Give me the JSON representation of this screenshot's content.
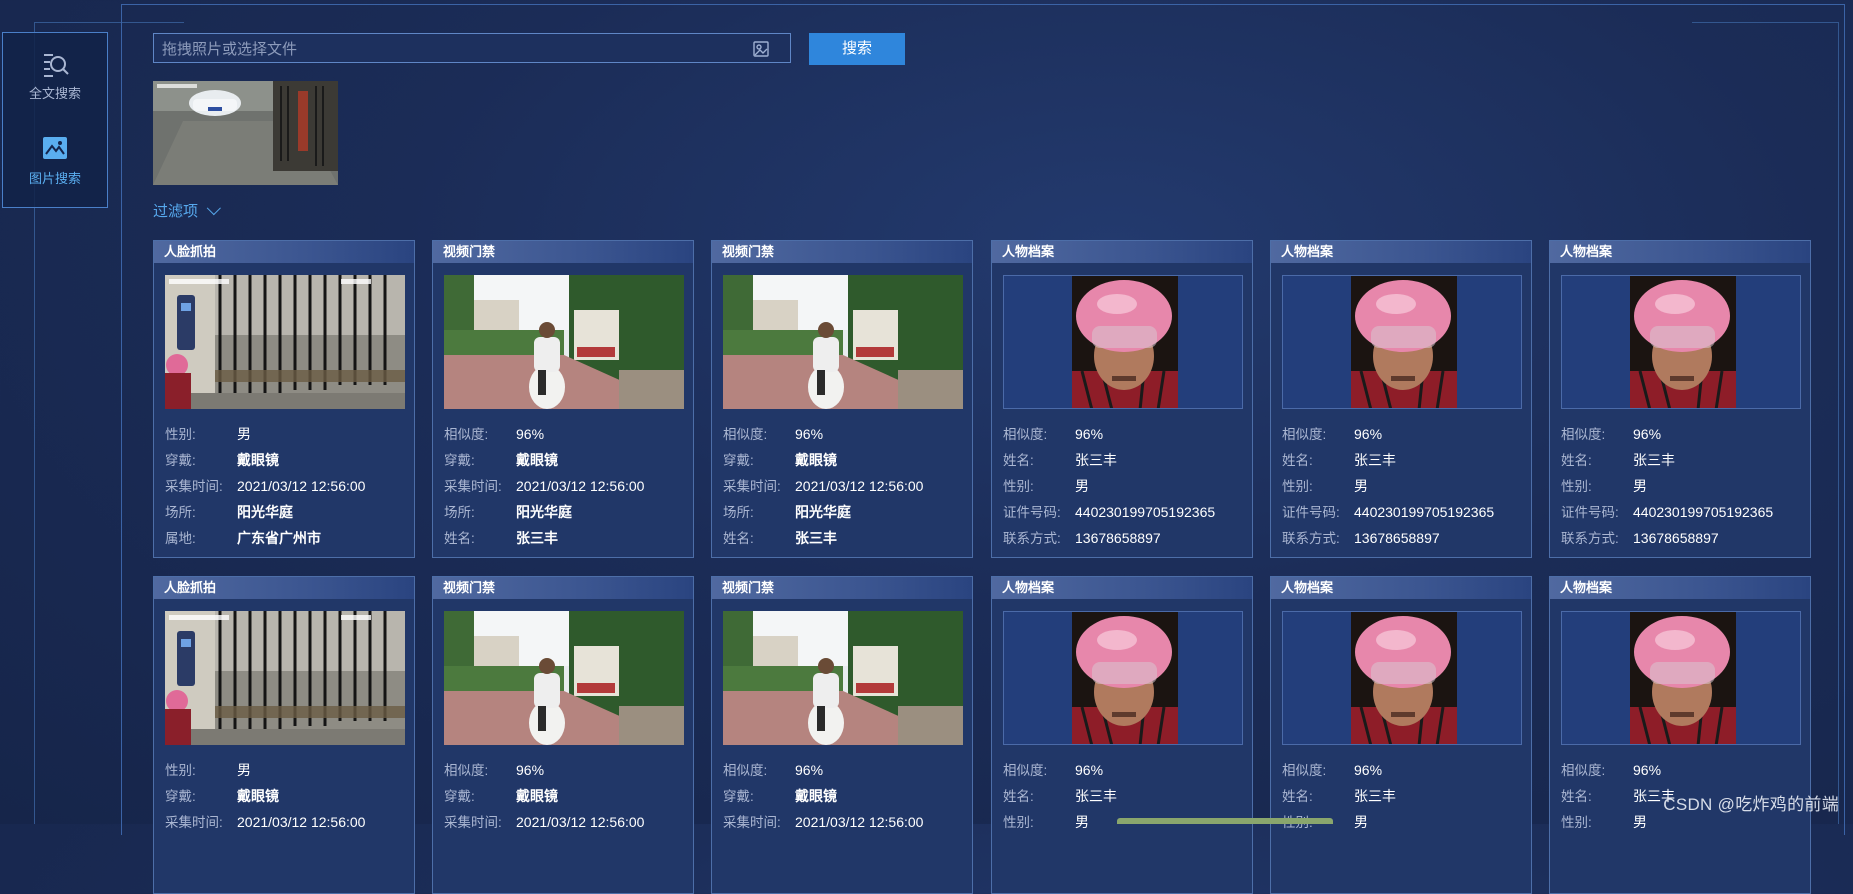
{
  "sidebar": {
    "items": [
      {
        "label": "全文搜索",
        "icon": "search-document-icon",
        "active": false
      },
      {
        "label": "图片搜索",
        "icon": "image-search-icon",
        "active": true
      }
    ]
  },
  "search": {
    "placeholder": "拖拽照片或选择文件",
    "value": "",
    "button_label": "搜索",
    "image_icon": "image-upload-icon"
  },
  "filter": {
    "label": "过滤项",
    "icon": "chevron-down-icon"
  },
  "cards": [
    {
      "type": "人脸抓拍",
      "image": "gate-snapshot",
      "fields": [
        {
          "k": "性别:",
          "v": "男",
          "bold": false
        },
        {
          "k": "穿戴:",
          "v": "戴眼镜",
          "bold": true
        },
        {
          "k": "采集时间:",
          "v": "2021/03/12 12:56:00",
          "bold": false
        },
        {
          "k": "场所:",
          "v": "阳光华庭",
          "bold": true
        },
        {
          "k": "属地:",
          "v": "广东省广州市",
          "bold": true
        }
      ]
    },
    {
      "type": "视频门禁",
      "image": "scooter-entrance",
      "fields": [
        {
          "k": "相似度:",
          "v": "96%",
          "bold": false
        },
        {
          "k": "穿戴:",
          "v": "戴眼镜",
          "bold": true
        },
        {
          "k": "采集时间:",
          "v": "2021/03/12 12:56:00",
          "bold": false
        },
        {
          "k": "场所:",
          "v": "阳光华庭",
          "bold": true
        },
        {
          "k": "姓名:",
          "v": "张三丰",
          "bold": true
        }
      ]
    },
    {
      "type": "视频门禁",
      "image": "scooter-entrance",
      "fields": [
        {
          "k": "相似度:",
          "v": "96%",
          "bold": false
        },
        {
          "k": "穿戴:",
          "v": "戴眼镜",
          "bold": true
        },
        {
          "k": "采集时间:",
          "v": "2021/03/12 12:56:00",
          "bold": false
        },
        {
          "k": "场所:",
          "v": "阳光华庭",
          "bold": true
        },
        {
          "k": "姓名:",
          "v": "张三丰",
          "bold": true
        }
      ]
    },
    {
      "type": "人物档案",
      "image": "helmet-portrait",
      "fields": [
        {
          "k": "相似度:",
          "v": "96%",
          "bold": false
        },
        {
          "k": "姓名:",
          "v": "张三丰",
          "bold": false
        },
        {
          "k": "性别:",
          "v": "男",
          "bold": false
        },
        {
          "k": "证件号码:",
          "v": "440230199705192365",
          "bold": false
        },
        {
          "k": "联系方式:",
          "v": "13678658897",
          "bold": false
        }
      ]
    },
    {
      "type": "人物档案",
      "image": "helmet-portrait",
      "fields": [
        {
          "k": "相似度:",
          "v": "96%",
          "bold": false
        },
        {
          "k": "姓名:",
          "v": "张三丰",
          "bold": false
        },
        {
          "k": "性别:",
          "v": "男",
          "bold": false
        },
        {
          "k": "证件号码:",
          "v": "440230199705192365",
          "bold": false
        },
        {
          "k": "联系方式:",
          "v": "13678658897",
          "bold": false
        }
      ]
    },
    {
      "type": "人物档案",
      "image": "helmet-portrait",
      "fields": [
        {
          "k": "相似度:",
          "v": "96%",
          "bold": false
        },
        {
          "k": "姓名:",
          "v": "张三丰",
          "bold": false
        },
        {
          "k": "性别:",
          "v": "男",
          "bold": false
        },
        {
          "k": "证件号码:",
          "v": "440230199705192365",
          "bold": false
        },
        {
          "k": "联系方式:",
          "v": "13678658897",
          "bold": false
        }
      ]
    },
    {
      "type": "人脸抓拍",
      "image": "gate-snapshot",
      "fields": [
        {
          "k": "性别:",
          "v": "男",
          "bold": false
        },
        {
          "k": "穿戴:",
          "v": "戴眼镜",
          "bold": true
        },
        {
          "k": "采集时间:",
          "v": "2021/03/12 12:56:00",
          "bold": false
        }
      ]
    },
    {
      "type": "视频门禁",
      "image": "scooter-entrance",
      "fields": [
        {
          "k": "相似度:",
          "v": "96%",
          "bold": false
        },
        {
          "k": "穿戴:",
          "v": "戴眼镜",
          "bold": true
        },
        {
          "k": "采集时间:",
          "v": "2021/03/12 12:56:00",
          "bold": false
        }
      ]
    },
    {
      "type": "视频门禁",
      "image": "scooter-entrance",
      "fields": [
        {
          "k": "相似度:",
          "v": "96%",
          "bold": false
        },
        {
          "k": "穿戴:",
          "v": "戴眼镜",
          "bold": true
        },
        {
          "k": "采集时间:",
          "v": "2021/03/12 12:56:00",
          "bold": false
        }
      ]
    },
    {
      "type": "人物档案",
      "image": "helmet-portrait",
      "fields": [
        {
          "k": "相似度:",
          "v": "96%",
          "bold": false
        },
        {
          "k": "姓名:",
          "v": "张三丰",
          "bold": false
        },
        {
          "k": "性别:",
          "v": "男",
          "bold": false
        }
      ]
    },
    {
      "type": "人物档案",
      "image": "helmet-portrait",
      "fields": [
        {
          "k": "相似度:",
          "v": "96%",
          "bold": false
        },
        {
          "k": "姓名:",
          "v": "张三丰",
          "bold": false
        },
        {
          "k": "性别:",
          "v": "男",
          "bold": false
        }
      ]
    },
    {
      "type": "人物档案",
      "image": "helmet-portrait",
      "fields": [
        {
          "k": "相似度:",
          "v": "96%",
          "bold": false
        },
        {
          "k": "姓名:",
          "v": "张三丰",
          "bold": false
        },
        {
          "k": "性别:",
          "v": "男",
          "bold": false
        }
      ]
    }
  ],
  "watermark": "CSDN @吃炸鸡的前端",
  "colors": {
    "accent": "#2f86dc",
    "link": "#57a9ee",
    "background": "#1b2c57",
    "card": "#213768"
  }
}
